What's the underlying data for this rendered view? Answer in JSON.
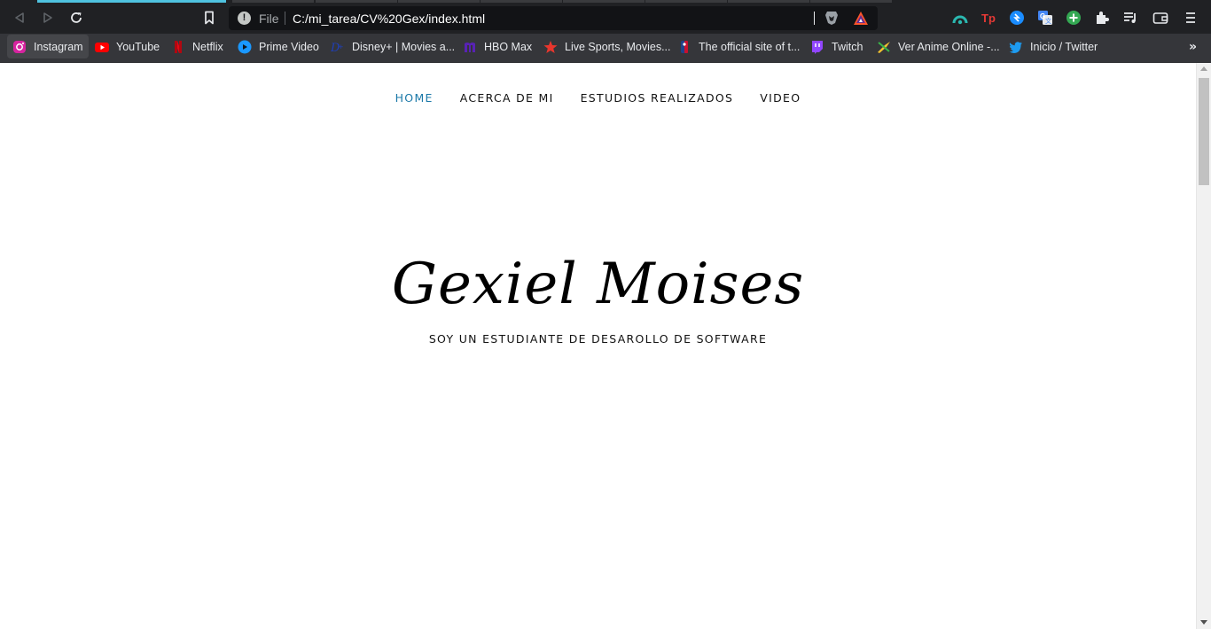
{
  "browser": {
    "address_bar": {
      "scheme_label": "File",
      "url": "C:/mi_tarea/CV%20Gex/index.html"
    },
    "toolbar_icons": [
      "back-icon",
      "forward-icon",
      "reload-icon",
      "bookmark-icon",
      "brave-shields-icon",
      "brave-rewards-icon"
    ],
    "extension_icons": [
      "speedometer-extension-icon",
      "tp-extension-icon",
      "shazam-extension-icon",
      "google-translate-extension-icon",
      "add-extension-icon",
      "puzzle-extensions-icon",
      "media-queue-icon",
      "wallet-icon",
      "menu-icon"
    ],
    "accent_color": "#4fc3e0"
  },
  "bookmarks": [
    {
      "label": "Instagram",
      "icon": "instagram-icon"
    },
    {
      "label": "YouTube",
      "icon": "youtube-icon"
    },
    {
      "label": "Netflix",
      "icon": "netflix-icon"
    },
    {
      "label": "Prime Video",
      "icon": "prime-video-icon"
    },
    {
      "label": "Disney+ | Movies a...",
      "icon": "disney-plus-icon"
    },
    {
      "label": "HBO Max",
      "icon": "hbo-max-icon"
    },
    {
      "label": "Live Sports, Movies...",
      "icon": "star-icon"
    },
    {
      "label": "The official site of t...",
      "icon": "nba-icon"
    },
    {
      "label": "Twitch",
      "icon": "twitch-icon"
    },
    {
      "label": "Ver Anime Online -...",
      "icon": "anime-icon"
    },
    {
      "label": "Inicio / Twitter",
      "icon": "twitter-icon"
    }
  ],
  "page": {
    "nav": {
      "home": "HOME",
      "about": "ACERCA DE MI",
      "studies": "ESTUDIOS REALIZADOS",
      "video": "VIDEO"
    },
    "active_nav_color": "#1a78a8",
    "hero": {
      "name": "Gexiel Moises",
      "subtitle": "SOY UN ESTUDIANTE DE DESAROLLO DE SOFTWARE"
    }
  }
}
